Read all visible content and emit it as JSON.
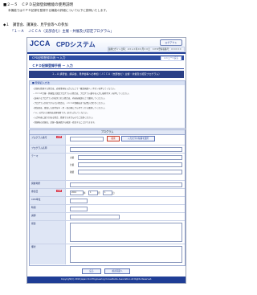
{
  "doc": {
    "heading": "■２－５　ＣＰＤ記録登録機能の使用説明",
    "intro": "本機能ではＣＰＤ記録を登録する機能の詳細について以下に説明いたします。",
    "section": "◆１　講習会、講演会、見学会等への参加",
    "subsection": "「１－Ａ　ＪＣＣＡ（支部含む）主催・共催及び認定プログラム」"
  },
  "app": {
    "logo": "JCCA",
    "system_name": "CPDシステム",
    "logout_label": "ログアウト",
    "user_info": "最終ログイン日時：２０１０年００月００日　ＣＰＤ登録者番号：０００００　ＣＰＤ太郎　様",
    "title_bar": "CPD記録登録手続 → 入力",
    "back_label": "メニューへ戻る",
    "page_title": "ＣＰＤ記録登録手続 － 入力",
    "notice": "１－Ａ 講習会、講演会、見学会等への参加（ＪＣＣＡ（支部含む）主催・共催及び認定プログラム）"
  },
  "instructions": {
    "heading": "■ 登録記入方法",
    "lines": [
      "・記録を登録する場合は、必要事項を入力した上で「確認画面へ」ボタンを押してください。",
      "・ＪＣＣＡ主催・共催及び認定プログラムの場合は、プログラム番号を入力し検索ボタンを押してください。",
      "・該当するプログラムが表示された場合は、内容を確認の上で選択してください。",
      "・プログラムが見つからない場合は、ＪＣＣＡ事務局までお問い合わせください。",
      "・参加日は、参加した日付を年・月・日の順にプルダウンから選択してください。",
      "・「＊」の付いた項目は必須項目です。必ず入力してください。",
      "・入力内容に誤りがある場合、登録できませんのでご注意ください。",
      "・登録後の記録は、記録一覧画面から確認・修正することができます。"
    ]
  },
  "form": {
    "header": "プログラム",
    "required_tag": "必須",
    "program_search_label": "プログラム番号",
    "search_button": "検索",
    "select_program_button": "入力文字の候補を選択",
    "program_name_label": "プログラム名称",
    "theme_label": "テーマ",
    "sponsor_label": "主催",
    "venue_label": "開催場所",
    "date_label": "参加日",
    "date_sub_labels": [
      "年",
      "月",
      "日"
    ],
    "date_values": [
      "2010",
      "1",
      "1"
    ],
    "units_label": "CPD単位",
    "hours_label": "時間",
    "organizer_label": "講師",
    "report_label": "報告",
    "remarks_label": "備考",
    "rows_sub": [
      "主催",
      "共催",
      "後援"
    ]
  },
  "actions": {
    "back": "戻る",
    "confirm": "確認画面へ"
  },
  "footer": {
    "copyright": "Copyright(C) 2010 Japan Civil Engineering Consultants Association All Rights Reserved."
  }
}
